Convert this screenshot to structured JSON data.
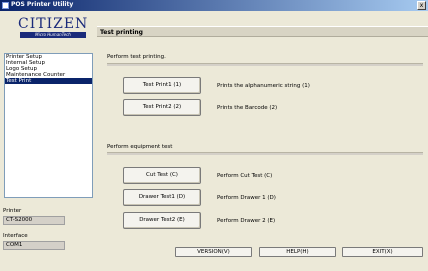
{
  "window": {
    "title": "POS Printer Utility",
    "close_label": "x"
  },
  "logo": {
    "brand": "CITIZEN",
    "tagline": "Micro HumanTech"
  },
  "menu": {
    "items": [
      {
        "label": "Printer Setup",
        "selected": false
      },
      {
        "label": "Internal Setup",
        "selected": false
      },
      {
        "label": "Logo Setup",
        "selected": false
      },
      {
        "label": "Maintenance Counter",
        "selected": false
      },
      {
        "label": "Test Print",
        "selected": true
      }
    ]
  },
  "printer": {
    "label": "Printer",
    "value": "CT-S2000"
  },
  "interface": {
    "label": "Interface",
    "value": "COM1"
  },
  "header": {
    "title": "Test printing"
  },
  "test_section": {
    "label": "Perform test printing.",
    "rows": [
      {
        "button": "Test Print1 (1)",
        "description": "Prints the alphanumeric string (1)"
      },
      {
        "button": "Test Print2 (2)",
        "description": "Prints the Barcode (2)"
      }
    ]
  },
  "equipment_section": {
    "label": "Perform equipment test",
    "rows": [
      {
        "button": "Cut Test (C)",
        "description": "Perform Cut Test (C)"
      },
      {
        "button": "Drawer Test1 (D)",
        "description": "Perform Drawer 1 (D)"
      },
      {
        "button": "Drawer Test2 (E)",
        "description": "Perform Drawer 2 (E)"
      }
    ]
  },
  "footer": {
    "version": "VERSION(V)",
    "help": "HELP(H)",
    "exit": "EXIT(X)"
  }
}
